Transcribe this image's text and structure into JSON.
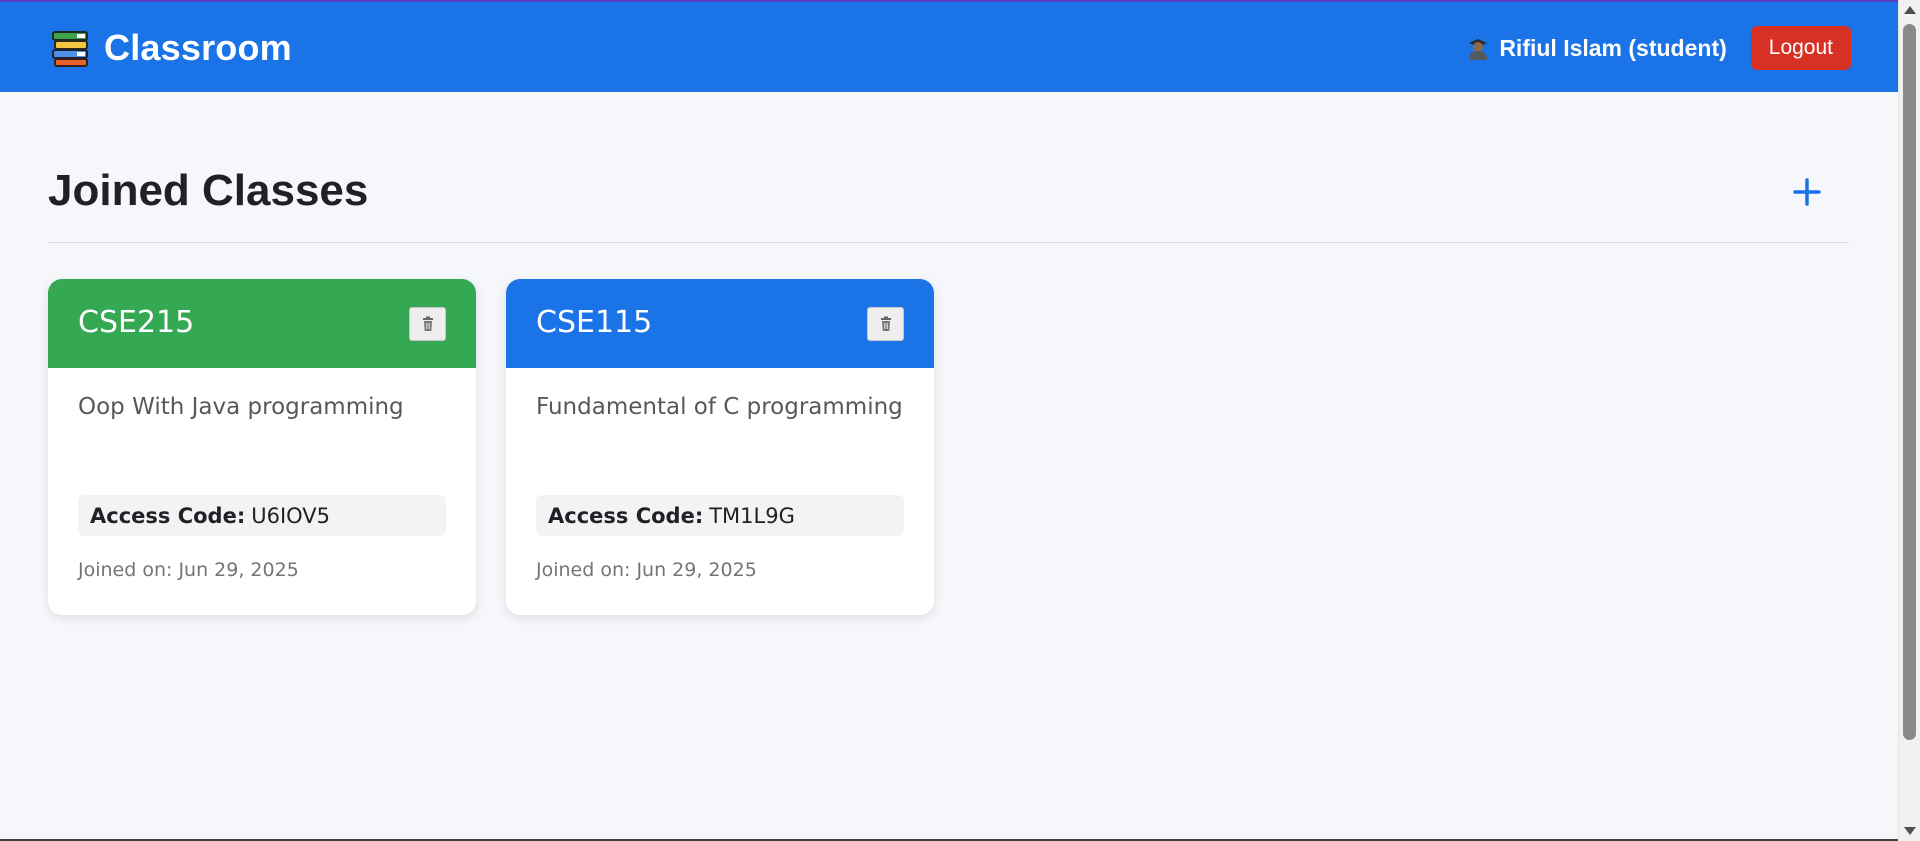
{
  "header": {
    "brand_title": "Classroom",
    "brand_icon": "books-icon",
    "user_icon": "student-avatar-icon",
    "user_label": "Rifiul Islam (student)",
    "logout_label": "Logout"
  },
  "main": {
    "title": "Joined Classes",
    "add_icon": "plus-icon"
  },
  "classes": [
    {
      "code": "CSE215",
      "name": "Oop With Java programming",
      "access_label": "Access Code:",
      "access_code": "U6IOV5",
      "joined": "Joined on: Jun 29, 2025",
      "color": "#34a853"
    },
    {
      "code": "CSE115",
      "name": "Fundamental of C programming",
      "access_label": "Access Code:",
      "access_code": "TM1L9G",
      "joined": "Joined on: Jun 29, 2025",
      "color": "#1b73e8"
    }
  ],
  "colors": {
    "header_bg": "#1b73e8",
    "logout_bg": "#d93025",
    "accent": "#1b73e8",
    "page_bg": "#f5f7fb"
  }
}
